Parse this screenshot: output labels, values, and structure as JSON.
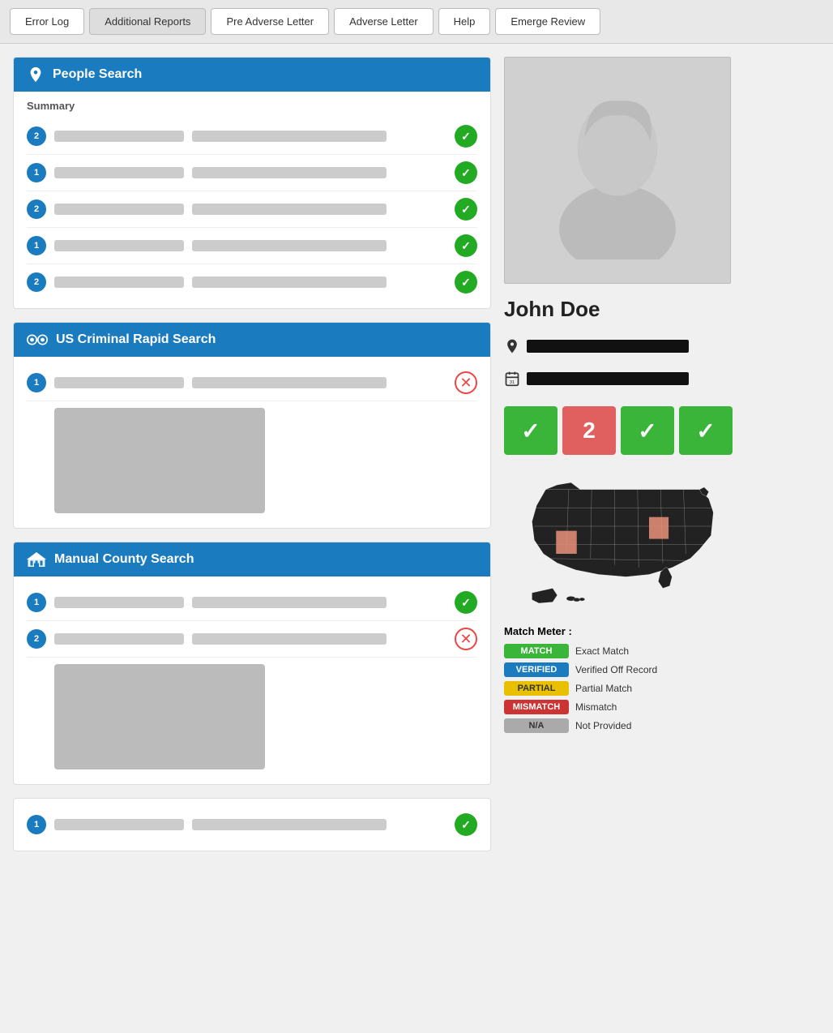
{
  "nav": {
    "buttons": [
      {
        "id": "error-log",
        "label": "Error Log"
      },
      {
        "id": "additional-reports",
        "label": "Additional Reports"
      },
      {
        "id": "pre-adverse-letter",
        "label": "Pre Adverse Letter"
      },
      {
        "id": "adverse-letter",
        "label": "Adverse Letter"
      },
      {
        "id": "help",
        "label": "Help"
      },
      {
        "id": "emerge-review",
        "label": "Emerge Review"
      }
    ]
  },
  "sections": {
    "people_search": {
      "title": "People Search",
      "summary_label": "Summary",
      "rows": [
        {
          "badge": "2",
          "status": "green"
        },
        {
          "badge": "1",
          "status": "green"
        },
        {
          "badge": "2",
          "status": "green"
        },
        {
          "badge": "1",
          "status": "green"
        },
        {
          "badge": "2",
          "status": "green"
        }
      ]
    },
    "criminal_rapid": {
      "title": "US Criminal Rapid Search",
      "rows": [
        {
          "badge": "1",
          "status": "red"
        }
      ]
    },
    "manual_county": {
      "title": "Manual County Search",
      "rows": [
        {
          "badge": "1",
          "status": "green"
        },
        {
          "badge": "2",
          "status": "red"
        }
      ]
    }
  },
  "person": {
    "name": "John Doe",
    "location_bar": "",
    "date_bar": ""
  },
  "match_badges": [
    {
      "type": "green-check",
      "display": "✓"
    },
    {
      "type": "red-num",
      "display": "2"
    },
    {
      "type": "green-check",
      "display": "✓"
    },
    {
      "type": "green-check",
      "display": "✓"
    }
  ],
  "match_meter": {
    "title": "Match Meter :",
    "items": [
      {
        "tag": "MATCH",
        "tag_class": "match",
        "label": "Exact Match"
      },
      {
        "tag": "VERIFIED",
        "tag_class": "verified",
        "label": "Verified Off Record"
      },
      {
        "tag": "PARTIAL",
        "tag_class": "partial",
        "label": "Partial Match"
      },
      {
        "tag": "MISMATCH",
        "tag_class": "mismatch",
        "label": "Mismatch"
      },
      {
        "tag": "N/A",
        "tag_class": "na",
        "label": "Not Provided"
      }
    ]
  }
}
